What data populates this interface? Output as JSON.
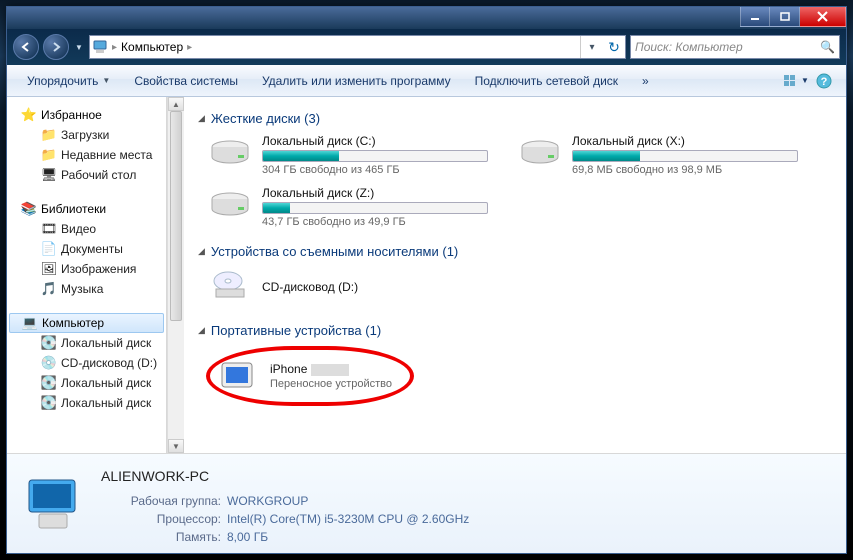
{
  "titlebar": {},
  "nav": {
    "computer_icon": "computer",
    "breadcrumb": "Компьютер",
    "search_placeholder": "Поиск: Компьютер"
  },
  "toolbar": {
    "organize": "Упорядочить",
    "sys_props": "Свойства системы",
    "uninstall": "Удалить или изменить программу",
    "map_drive": "Подключить сетевой диск",
    "overflow": "»"
  },
  "sidebar": {
    "favorites": {
      "label": "Избранное",
      "items": [
        "Загрузки",
        "Недавние места",
        "Рабочий стол"
      ]
    },
    "libraries": {
      "label": "Библиотеки",
      "items": [
        "Видео",
        "Документы",
        "Изображения",
        "Музыка"
      ]
    },
    "computer": {
      "label": "Компьютер",
      "items": [
        "Локальный диск",
        "CD-дисковод (D:)",
        "Локальный диск",
        "Локальный диск"
      ]
    }
  },
  "sections": {
    "hdd": {
      "title": "Жесткие диски (3)"
    },
    "removable": {
      "title": "Устройства со съемными носителями (1)"
    },
    "portable": {
      "title": "Портативные устройства (1)"
    }
  },
  "drives": [
    {
      "name": "Локальный диск (C:)",
      "free": "304 ГБ свободно из 465 ГБ",
      "fill": 34
    },
    {
      "name": "Локальный диск (X:)",
      "free": "69,8 МБ свободно из 98,9 МБ",
      "fill": 30
    },
    {
      "name": "Локальный диск (Z:)",
      "free": "43,7 ГБ свободно из 49,9 ГБ",
      "fill": 12
    }
  ],
  "removable": [
    {
      "name": "CD-дисковод (D:)"
    }
  ],
  "portable": [
    {
      "name": "iPhone",
      "sub": "Переносное устройство"
    }
  ],
  "details": {
    "name": "ALIENWORK-PC",
    "rows": [
      {
        "label": "Рабочая группа:",
        "value": "WORKGROUP"
      },
      {
        "label": "Процессор:",
        "value": "Intel(R) Core(TM) i5-3230M CPU @ 2.60GHz"
      },
      {
        "label": "Память:",
        "value": "8,00 ГБ"
      }
    ]
  }
}
